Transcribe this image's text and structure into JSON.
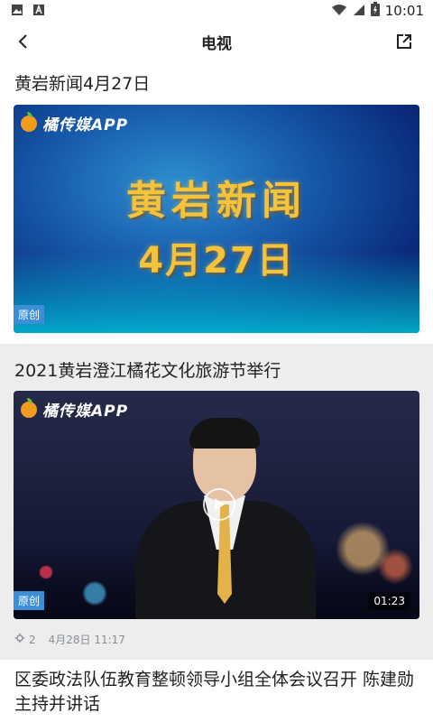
{
  "status_bar": {
    "time": "10:01",
    "icons": [
      "image-icon",
      "text-a-icon",
      "wifi-icon",
      "cell-signal-icon",
      "battery-icon"
    ]
  },
  "toolbar": {
    "title": "电视",
    "back_icon": "chevron-left-icon",
    "share_icon": "share-external-icon"
  },
  "items": [
    {
      "title": "黄岩新闻4月27日",
      "thumb_logo": "橘传媒APP",
      "thumb_headline": "黄岩新闻",
      "thumb_subline": "4月27日",
      "badge": "原创"
    },
    {
      "title": "2021黄岩澄江橘花文化旅游节举行",
      "thumb_logo": "橘传媒APP",
      "badge": "原创",
      "duration": "01:23",
      "view_count": "2",
      "date": "4月28日 11:17"
    },
    {
      "title": "区委政法队伍教育整顿领导小组全体会议召开 陈建勋主持并讲话"
    }
  ],
  "colors": {
    "accent_badge": "#3a8fd8",
    "headline_gold": "#f3c33c",
    "meta_grey": "#8a8f96"
  }
}
